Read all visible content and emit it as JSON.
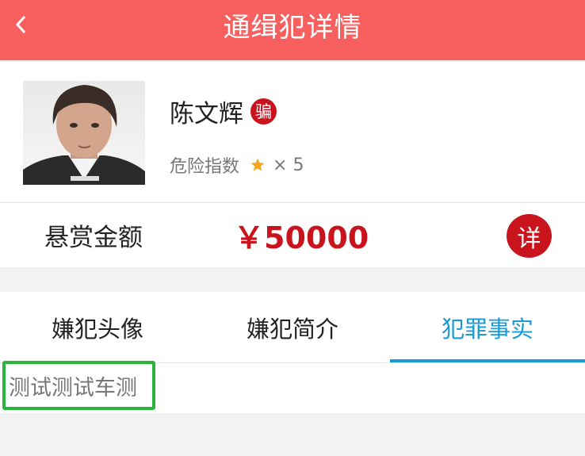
{
  "header": {
    "title": "通缉犯详情",
    "back_icon": "back-arrow-icon"
  },
  "profile": {
    "name": "陈文辉",
    "crime_badge": "骗",
    "danger_label": "危险指数",
    "danger_stars_shown": 1,
    "danger_multiplier": "× 5"
  },
  "reward": {
    "label": "悬赏金额",
    "amount": "￥50000",
    "detail_button": "详"
  },
  "tabs": [
    {
      "label": "嫌犯头像",
      "active": false
    },
    {
      "label": "嫌犯简介",
      "active": false
    },
    {
      "label": "犯罪事实",
      "active": true
    }
  ],
  "content": {
    "text": "测试测试车测"
  },
  "colors": {
    "header_bg": "#f8605f",
    "accent_red": "#c9141d",
    "tab_active": "#1a9ad6",
    "highlight_border": "#2ab33d",
    "star": "#f5a623"
  }
}
